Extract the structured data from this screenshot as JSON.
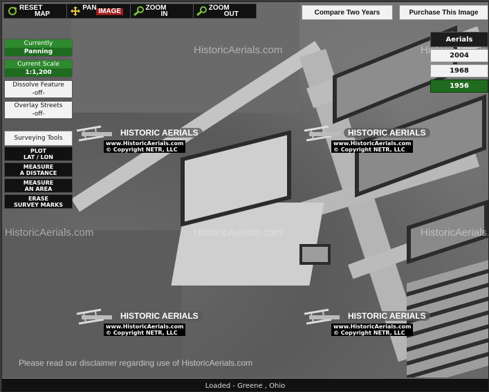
{
  "toolbar": {
    "reset": {
      "line1": "RESET",
      "line2": "MAP"
    },
    "pan": {
      "line1": "PAN",
      "line2": "IMAGE"
    },
    "zoomin": {
      "line1": "ZOOM",
      "line2": "IN"
    },
    "zoomout": {
      "line1": "ZOOM",
      "line2": "OUT"
    }
  },
  "top_buttons": {
    "compare": "Compare Two Years",
    "purchase": "Purchase This Image"
  },
  "aerials": {
    "header": "Aerials",
    "years": [
      "2004",
      "1968",
      "1956"
    ],
    "active": "1956"
  },
  "left_panel": {
    "currently": {
      "label": "Currently",
      "value": "Panning"
    },
    "scale": {
      "label": "Current Scale",
      "value": "1:1,200"
    },
    "dissolve": {
      "label": "Dissolve Feature",
      "value": "-off-"
    },
    "overlay": {
      "label": "Overlay Streets",
      "value": "-off-"
    },
    "surveying_header": "Surveying Tools",
    "tools": [
      {
        "line1": "PLOT",
        "line2": "LAT / LON"
      },
      {
        "line1": "MEASURE",
        "line2": "A DISTANCE"
      },
      {
        "line1": "MEASURE",
        "line2": "AN AREA"
      },
      {
        "line1": "ERASE",
        "line2": "SURVEY MARKS"
      }
    ]
  },
  "watermarks": {
    "site": "HistoricAerials.com",
    "brand": "HISTORIC AERIALS",
    "url": "www.HistoricAerials.com",
    "copyright": "© Copyright NETR, LLC"
  },
  "disclaimer": "Please read our disclaimer regarding use of HistoricAerials.com",
  "status": "Loaded - Greene , Ohio",
  "colors": {
    "accent_green": "#1f6b1f",
    "toolbar_black": "#111111"
  }
}
